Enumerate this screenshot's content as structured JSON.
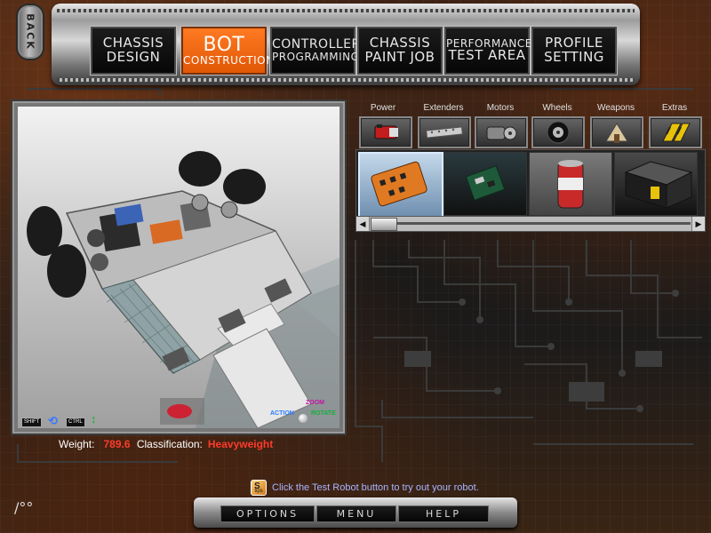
{
  "nav": {
    "back_label": "BACK",
    "tabs": [
      {
        "line1": "CHASSIS",
        "line2": "DESIGN"
      },
      {
        "line1": "BOT",
        "line2": "CONSTRUCTION",
        "active": true
      },
      {
        "line1": "CONTROLLER",
        "line2": "PROGRAMMING"
      },
      {
        "line1": "CHASSIS",
        "line2": "PAINT JOB"
      },
      {
        "line1": "PERFORMANCE",
        "line2": "TEST AREA"
      },
      {
        "line1": "PROFILE",
        "line2": "SETTING"
      }
    ]
  },
  "viewport": {
    "hud": {
      "shift_key": "SHIFT",
      "ctrl_key": "CTRL",
      "zoom": "ZOOM",
      "action": "ACTION",
      "rotate": "ROTATE"
    }
  },
  "parts": {
    "categories": [
      {
        "label": "Power",
        "icon": "battery-icon"
      },
      {
        "label": "Extenders",
        "icon": "extender-bar-icon"
      },
      {
        "label": "Motors",
        "icon": "motor-icon"
      },
      {
        "label": "Wheels",
        "icon": "wheel-icon"
      },
      {
        "label": "Weapons",
        "icon": "weapon-icon"
      },
      {
        "label": "Extras",
        "icon": "extras-icon"
      }
    ],
    "tray_items": [
      {
        "icon": "speed-controller-icon",
        "selected": true
      },
      {
        "icon": "circuit-board-icon"
      },
      {
        "icon": "canister-battery-icon"
      },
      {
        "icon": "box-battery-icon"
      }
    ]
  },
  "status": {
    "weight_label": "Weight:",
    "weight_value": "789.6",
    "class_label": "Classification:",
    "class_value": "Heavyweight"
  },
  "tip": {
    "icon_label": "tips",
    "text": "Click the Test Robot button to try out your robot."
  },
  "bottom": {
    "options": "OPTIONS",
    "menu": "MENU",
    "help": "HELP"
  },
  "corner_mark": "/°°",
  "colors": {
    "accent_orange": "#f06a12",
    "value_red": "#ff3a2a",
    "tip_blue": "#a9b4ff"
  }
}
